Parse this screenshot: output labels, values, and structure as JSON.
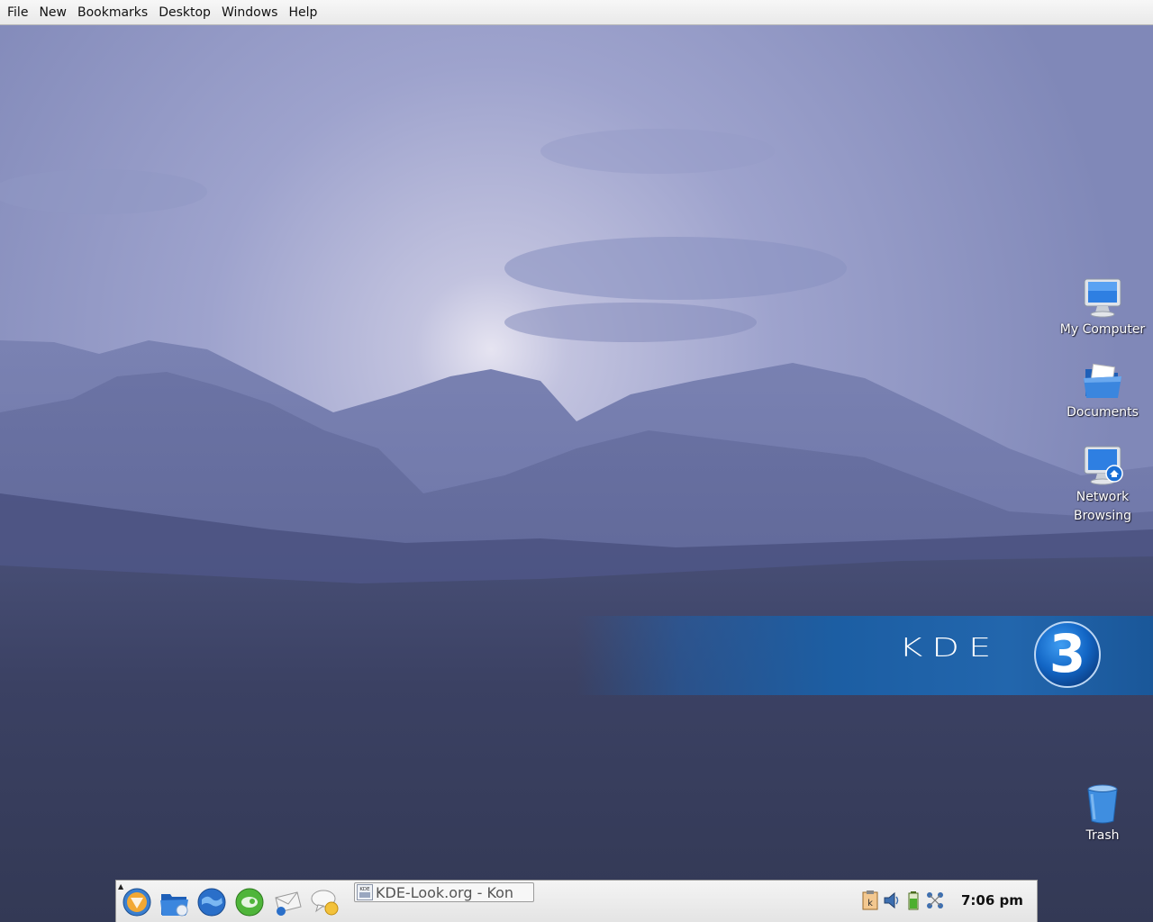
{
  "menubar": {
    "items": [
      "File",
      "New",
      "Bookmarks",
      "Desktop",
      "Windows",
      "Help"
    ]
  },
  "desktop": {
    "icons": [
      {
        "label": "My Computer",
        "icon": "monitor-icon"
      },
      {
        "label": "Documents",
        "icon": "folder-icon"
      },
      {
        "label": "Network Browsing",
        "icon": "network-monitor-icon"
      },
      {
        "label": "Trash",
        "icon": "trash-icon"
      }
    ],
    "banner_text": "KDE",
    "banner_digit": "3"
  },
  "taskbar": {
    "launchers": [
      "kmenu-icon",
      "home-folder-icon",
      "browser-globe-icon",
      "suse-icon",
      "mail-icon",
      "chat-icon"
    ],
    "task": {
      "label": "KDE-Look.org - Kon",
      "icon_text": "KDE"
    },
    "tray": [
      "klipper-icon",
      "volume-icon",
      "battery-icon",
      "network-icon"
    ],
    "clock": "7:06 pm"
  },
  "colors": {
    "sky_top": "#8e95c3",
    "sky_glow": "#d8d8ec",
    "mountain": "#5b638f",
    "ground": "#343a55",
    "banner": "#1c5ea3"
  }
}
